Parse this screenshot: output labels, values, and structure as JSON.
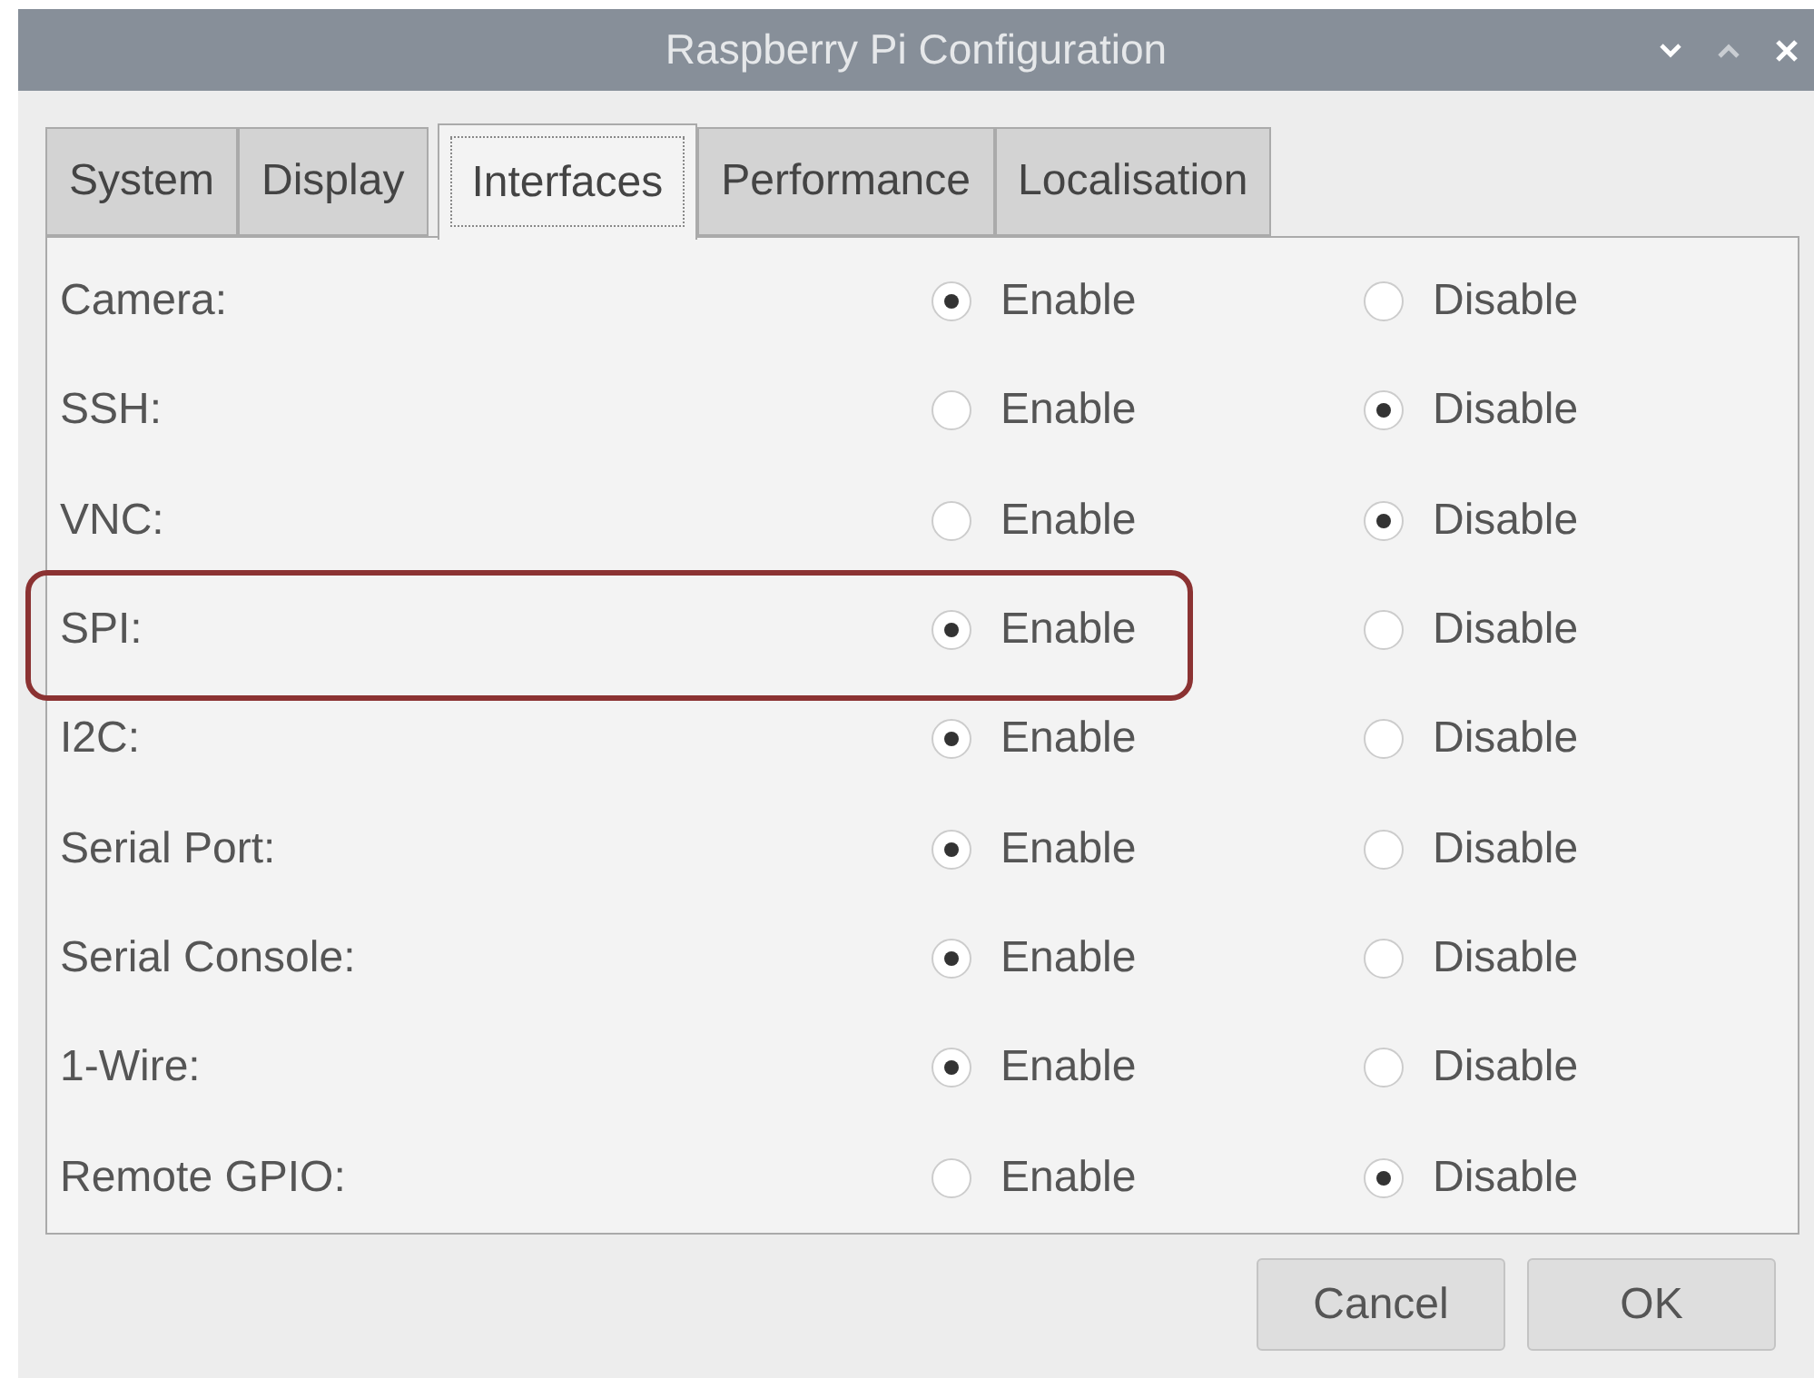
{
  "window": {
    "title": "Raspberry Pi Configuration"
  },
  "tabs": [
    {
      "label": "System",
      "selected": false
    },
    {
      "label": "Display",
      "selected": false
    },
    {
      "label": "Interfaces",
      "selected": true
    },
    {
      "label": "Performance",
      "selected": false
    },
    {
      "label": "Localisation",
      "selected": false
    }
  ],
  "rows": [
    {
      "label": "Camera:",
      "highlighted": false,
      "options": [
        {
          "label": "Enable",
          "selected": true
        },
        {
          "label": "Disable",
          "selected": false
        }
      ]
    },
    {
      "label": "SSH:",
      "highlighted": false,
      "options": [
        {
          "label": "Enable",
          "selected": false
        },
        {
          "label": "Disable",
          "selected": true
        }
      ]
    },
    {
      "label": "VNC:",
      "highlighted": false,
      "options": [
        {
          "label": "Enable",
          "selected": false
        },
        {
          "label": "Disable",
          "selected": true
        }
      ]
    },
    {
      "label": "SPI:",
      "highlighted": true,
      "options": [
        {
          "label": "Enable",
          "selected": true
        },
        {
          "label": "Disable",
          "selected": false
        }
      ]
    },
    {
      "label": "I2C:",
      "highlighted": false,
      "options": [
        {
          "label": "Enable",
          "selected": true
        },
        {
          "label": "Disable",
          "selected": false
        }
      ]
    },
    {
      "label": "Serial Port:",
      "highlighted": false,
      "options": [
        {
          "label": "Enable",
          "selected": true
        },
        {
          "label": "Disable",
          "selected": false
        }
      ]
    },
    {
      "label": "Serial Console:",
      "highlighted": false,
      "options": [
        {
          "label": "Enable",
          "selected": true
        },
        {
          "label": "Disable",
          "selected": false
        }
      ]
    },
    {
      "label": "1-Wire:",
      "highlighted": false,
      "options": [
        {
          "label": "Enable",
          "selected": true
        },
        {
          "label": "Disable",
          "selected": false
        }
      ]
    },
    {
      "label": "Remote GPIO:",
      "highlighted": false,
      "options": [
        {
          "label": "Enable",
          "selected": false
        },
        {
          "label": "Disable",
          "selected": true
        }
      ]
    }
  ],
  "buttons": [
    "Cancel",
    "OK"
  ]
}
